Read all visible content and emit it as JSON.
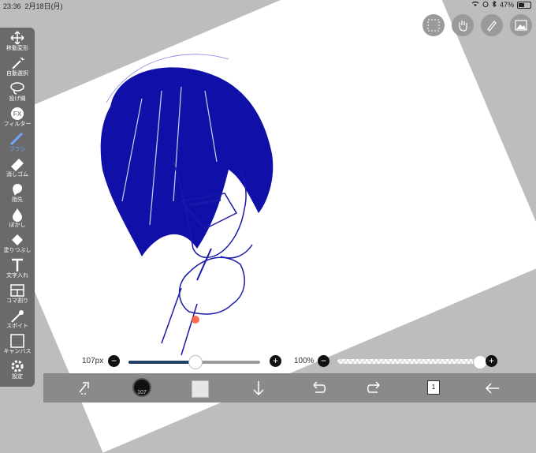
{
  "status_bar": {
    "time": "23:36",
    "date": "2月18日(月)",
    "battery": "47%",
    "battery_level": 0.47
  },
  "toolbar": {
    "items": [
      {
        "label": "移動変形",
        "icon": "move-icon"
      },
      {
        "label": "自動選択",
        "icon": "magic-wand-icon"
      },
      {
        "label": "投げ縄",
        "icon": "lasso-icon"
      },
      {
        "label": "フィルター",
        "icon": "fx-icon"
      },
      {
        "label": "ブラシ",
        "icon": "brush-icon",
        "active": true
      },
      {
        "label": "消しゴム",
        "icon": "eraser-icon"
      },
      {
        "label": "指先",
        "icon": "smudge-icon"
      },
      {
        "label": "ぼかし",
        "icon": "blur-icon"
      },
      {
        "label": "塗りつぶし",
        "icon": "bucket-icon"
      },
      {
        "label": "文字入れ",
        "icon": "text-icon"
      },
      {
        "label": "コマ割り",
        "icon": "frame-icon"
      },
      {
        "label": "スポイト",
        "icon": "eyedropper-icon"
      },
      {
        "label": "キャンバス",
        "icon": "canvas-icon"
      },
      {
        "label": "設定",
        "icon": "gear-icon"
      }
    ]
  },
  "top_buttons": [
    "selection-icon",
    "hand-icon",
    "pen-icon",
    "image-icon"
  ],
  "brush_size": {
    "label": "107px",
    "value_fraction": 0.5
  },
  "opacity": {
    "label": "100%",
    "value_fraction": 1.0
  },
  "bottom_bar": {
    "brush_preview_label": "107",
    "layers_count": "1",
    "icons": [
      "transform-icon",
      "brush-preview",
      "color-swatch",
      "arrow-down-icon",
      "undo-icon",
      "redo-icon",
      "layers-icon",
      "back-icon"
    ]
  },
  "colors": {
    "accent": "#2b5aa3",
    "ink": "#1a1aa8",
    "toolbar_bg": "#6a6a6a",
    "active_label": "#6fa8ff"
  }
}
